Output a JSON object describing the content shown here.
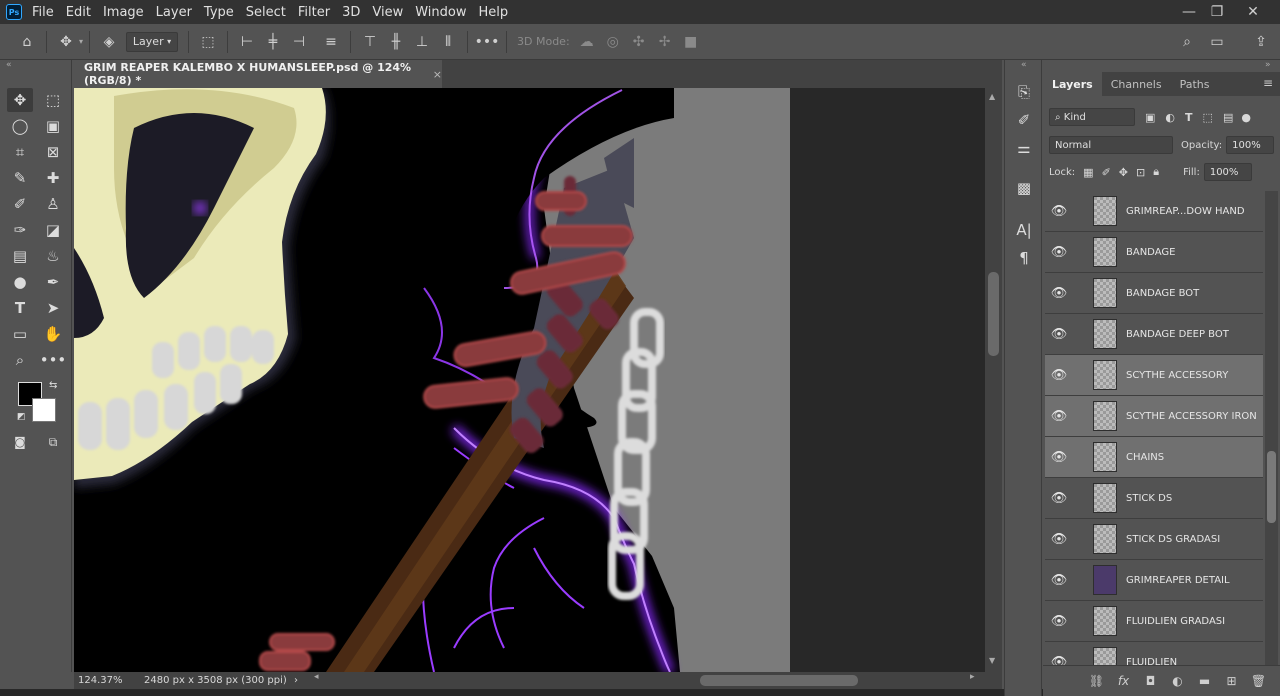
{
  "app": {
    "logo_text": "Ps"
  },
  "menu": [
    "File",
    "Edit",
    "Image",
    "Layer",
    "Type",
    "Select",
    "Filter",
    "3D",
    "View",
    "Window",
    "Help"
  ],
  "window_controls": {
    "minimize": "—",
    "restore": "❐",
    "close": "✕"
  },
  "options_bar": {
    "auto_select_target": "Layer",
    "mode_3d_label": "3D Mode:"
  },
  "document": {
    "tab_title": "GRIM REAPER KALEMBO X HUMANSLEEP.psd @ 124% (RGB/8) *",
    "close_glyph": "×"
  },
  "status": {
    "zoom": "124.37%",
    "doc_size": "2480 px x 3508 px (300 ppi)",
    "arrow": "›"
  },
  "panel": {
    "tabs": [
      "Layers",
      "Channels",
      "Paths"
    ],
    "filter_kind": "Kind",
    "blend_mode": "Normal",
    "opacity_label": "Opacity:",
    "opacity_value": "100%",
    "lock_label": "Lock:",
    "fill_label": "Fill:",
    "fill_value": "100%",
    "layers": [
      {
        "name": "GRIMREAP...DOW HAND",
        "visible": true,
        "selected": false
      },
      {
        "name": "BANDAGE",
        "visible": true,
        "selected": false
      },
      {
        "name": "BANDAGE BOT",
        "visible": true,
        "selected": false
      },
      {
        "name": "BANDAGE DEEP BOT",
        "visible": true,
        "selected": false
      },
      {
        "name": "SCYTHE ACCESSORY",
        "visible": true,
        "selected": true
      },
      {
        "name": "SCYTHE ACCESSORY IRON",
        "visible": true,
        "selected": true
      },
      {
        "name": "CHAINS",
        "visible": true,
        "selected": true
      },
      {
        "name": "STICK DS",
        "visible": true,
        "selected": false
      },
      {
        "name": "STICK DS GRADASI",
        "visible": true,
        "selected": false
      },
      {
        "name": "GRIMREAPER DETAIL",
        "visible": true,
        "selected": false
      },
      {
        "name": "FLUIDLIEN GRADASI",
        "visible": true,
        "selected": false
      },
      {
        "name": "FLUIDLIEN",
        "visible": true,
        "selected": false
      }
    ]
  },
  "colors": {
    "accent_glow": "#9a3cff",
    "skull": "#ebeab9",
    "bandage": "#8a3a3e"
  }
}
